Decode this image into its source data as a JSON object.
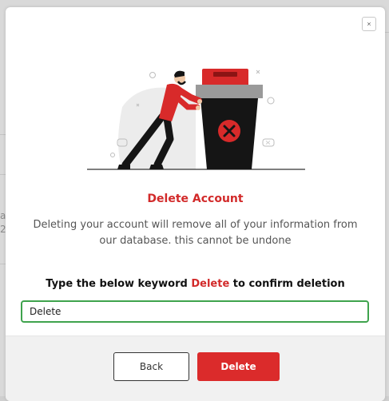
{
  "dialog": {
    "title": "Delete Account",
    "description": "Deleting your account will remove all of your information from our database. this cannot be undone",
    "prompt_before": "Type the below keyword",
    "keyword": "Delete",
    "prompt_after": "to confirm deletion",
    "input_value": "Delete",
    "close_icon": "close-icon",
    "illustration": "person-pushing-trash-bin"
  },
  "buttons": {
    "back_label": "Back",
    "delete_label": "Delete"
  },
  "background": {
    "partial_chars": [
      "a",
      "2"
    ]
  },
  "colors": {
    "accent_red": "#d22a2a",
    "delete_button": "#db2b2b",
    "input_border_valid": "#3fa34d",
    "footer_bg": "#f1f1f1"
  }
}
